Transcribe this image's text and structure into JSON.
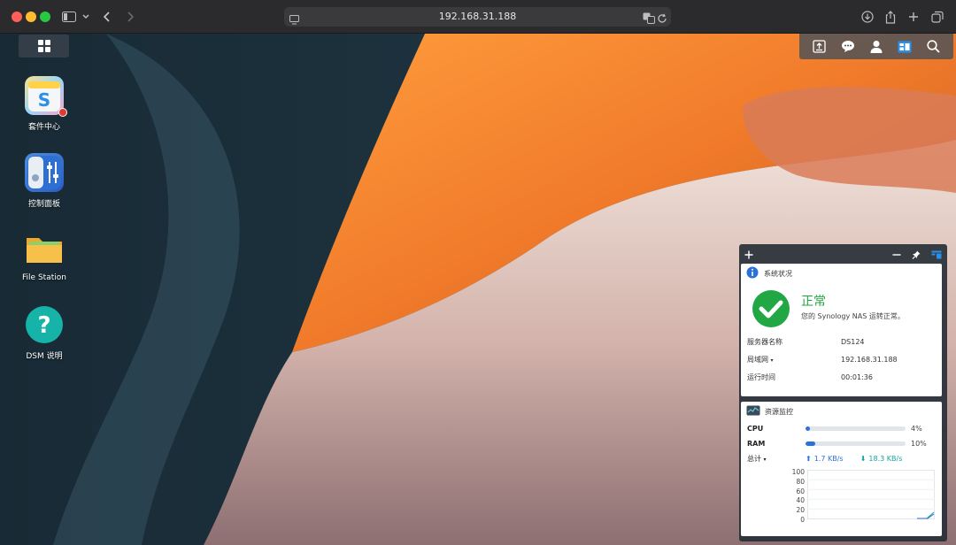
{
  "browser": {
    "url": "192.168.31.188"
  },
  "desktop_icons": [
    {
      "label": "套件中心"
    },
    {
      "label": "控制面板"
    },
    {
      "label": "File Station"
    },
    {
      "label": "DSM 说明"
    }
  ],
  "system_status": {
    "title": "系统状况",
    "status": "正常",
    "message": "您的 Synology NAS 运转正常。",
    "rows": [
      {
        "key": "服务器名称",
        "value": "DS124"
      },
      {
        "key": "局域网",
        "value": "192.168.31.188"
      },
      {
        "key": "运行时间",
        "value": "00:01:36"
      }
    ]
  },
  "resource_monitor": {
    "title": "资源监控",
    "cpu_label": "CPU",
    "cpu_percent": "4%",
    "cpu_value": 4,
    "ram_label": "RAM",
    "ram_percent": "10%",
    "ram_value": 10,
    "total_label": "总计",
    "upload": "1.7 KB/s",
    "download": "18.3 KB/s",
    "y_ticks": [
      "100",
      "80",
      "60",
      "40",
      "20",
      "0"
    ]
  },
  "colors": {
    "accent": "#2a72d8",
    "ok_green": "#21a744",
    "teal": "#13a5a5",
    "badge_red": "#e23b2e"
  }
}
